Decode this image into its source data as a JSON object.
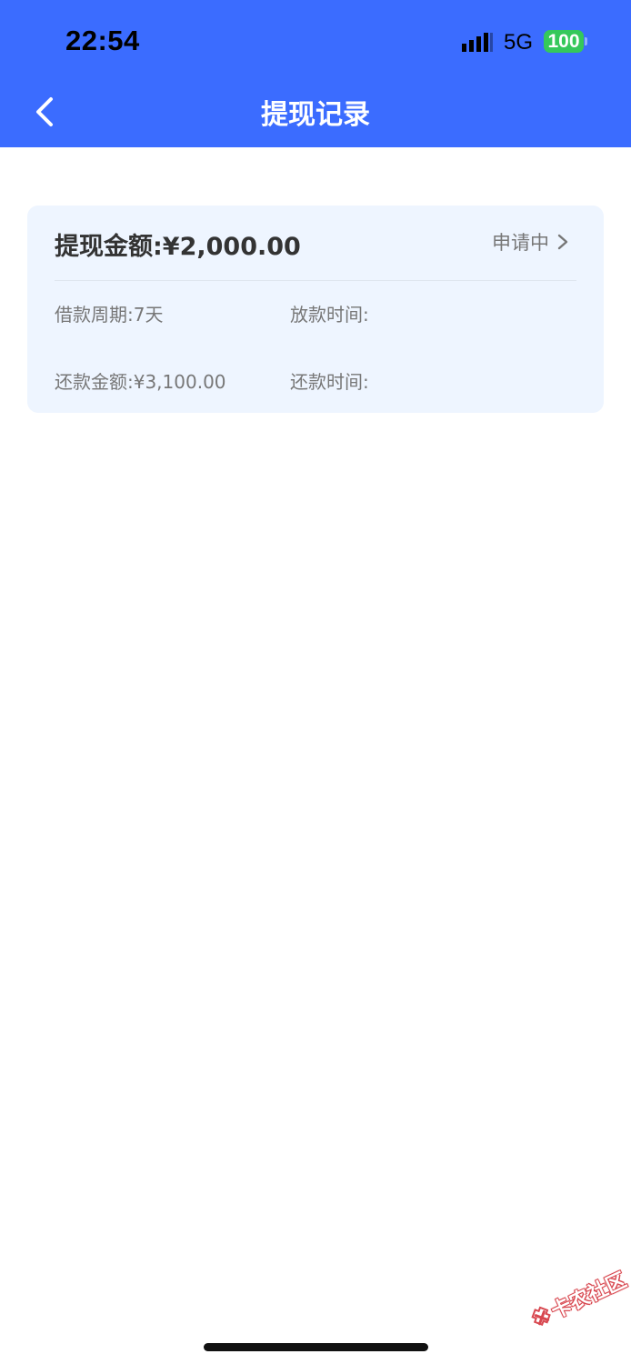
{
  "status_bar": {
    "time": "22:54",
    "network": "5G",
    "battery_level": "100",
    "signal_icon": "signal-bars",
    "battery_color": "#35c85b"
  },
  "nav": {
    "back_icon": "chevron-left",
    "title": "提现记录",
    "background_color": "#3b6cff"
  },
  "record": {
    "amount": "提现金额:¥2,000.00",
    "status": "申请中",
    "status_icon": "chevron-right",
    "loan_term": "借款周期:7天",
    "disbursement_time": "放款时间:",
    "repayment_amount": "还款金额:¥3,100.00",
    "repayment_time": "还款时间:"
  },
  "watermark": {
    "text": "卡农社区",
    "logo_icon": "kanong-logo"
  }
}
